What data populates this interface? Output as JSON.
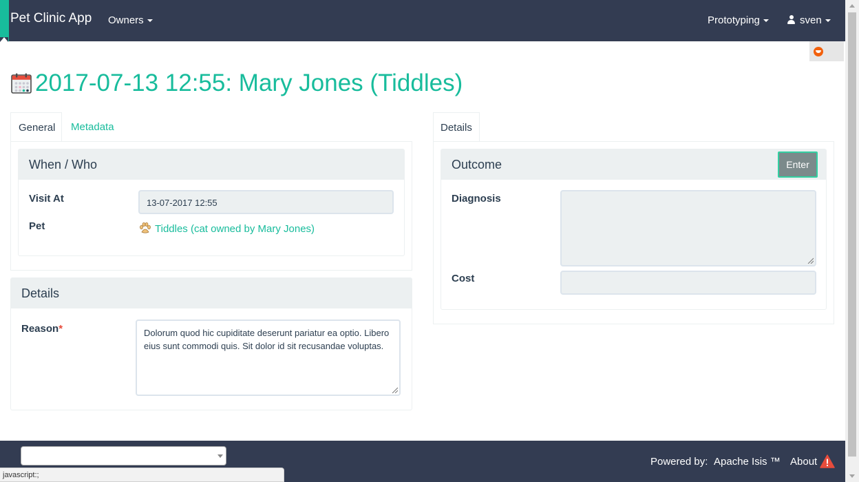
{
  "navbar": {
    "brand": "Pet Clinic App",
    "owners_menu": "Owners",
    "prototyping_menu": "Prototyping",
    "user_menu": "sven"
  },
  "page": {
    "title": "2017-07-13 12:55: Mary Jones (Tiddles)"
  },
  "left": {
    "tabs": [
      "General",
      "Metadata"
    ],
    "when_who": {
      "heading": "When / Who",
      "visit_at_label": "Visit At",
      "visit_at_value": "13-07-2017 12:55",
      "pet_label": "Pet",
      "pet_value": "Tiddles (cat owned by Mary Jones)"
    },
    "details": {
      "heading": "Details",
      "reason_label": "Reason",
      "reason_required_marker": "*",
      "reason_value": "Dolorum quod hic cupiditate deserunt pariatur ea optio. Libero eius sunt commodi quis. Sit dolor id sit recusandae voluptas."
    }
  },
  "right": {
    "tabs": [
      "Details"
    ],
    "outcome": {
      "heading": "Outcome",
      "enter_button": "Enter",
      "diagnosis_label": "Diagnosis",
      "diagnosis_value": "",
      "cost_label": "Cost",
      "cost_value": ""
    }
  },
  "footer": {
    "powered_by": "Powered by:",
    "apache_isis": "Apache Isis ™",
    "about": "About",
    "select_value": ""
  },
  "status_bar": "javascript:;",
  "colors": {
    "navbar": "#333c52",
    "accent": "#18bc9c",
    "panel_heading": "#ecf0f1",
    "button": "#7b8a8b",
    "warning": "#e74c3c"
  },
  "icons": [
    "calendar-icon",
    "paw-icon",
    "user-icon",
    "warning-icon",
    "widget-icon"
  ]
}
